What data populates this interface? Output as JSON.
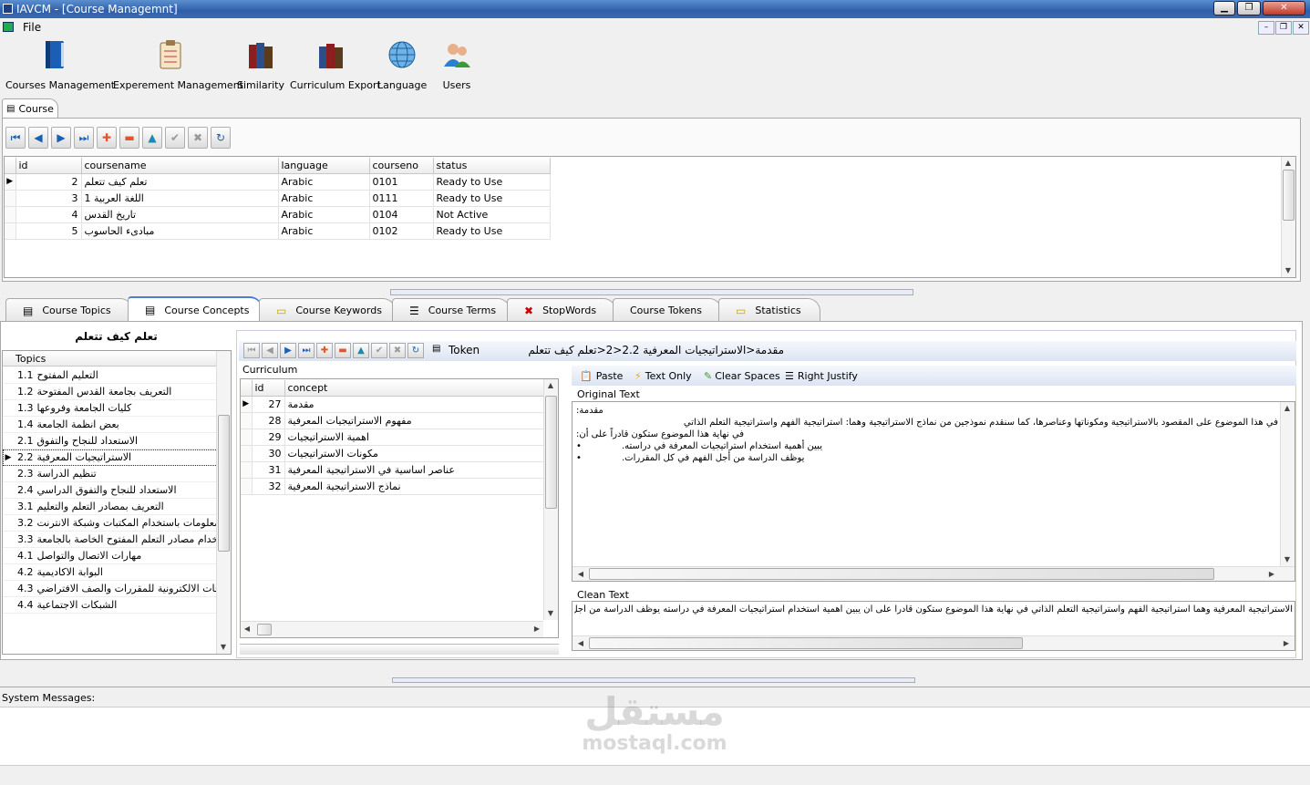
{
  "window": {
    "title": "IAVCM - [Course Managemnt]"
  },
  "menu": {
    "file": "File"
  },
  "toolbar": [
    {
      "label": "Courses Management",
      "icon": "book-icon"
    },
    {
      "label": "Experement Management",
      "icon": "clipboard-icon"
    },
    {
      "label": "Similarity",
      "icon": "books-icon"
    },
    {
      "label": "Curriculum Export",
      "icon": "books-export-icon"
    },
    {
      "label": "Language",
      "icon": "globe-icon"
    },
    {
      "label": "Users",
      "icon": "users-icon"
    }
  ],
  "course_tab": {
    "label": "Course"
  },
  "course_grid": {
    "columns": [
      "id",
      "coursename",
      "language",
      "courseno",
      "status"
    ],
    "rows": [
      {
        "id": "2",
        "name": "تعلم كيف تتعلم",
        "language": "Arabic",
        "courseno": "0101",
        "status": "Ready to Use"
      },
      {
        "id": "3",
        "name": "اللغة العربية 1",
        "language": "Arabic",
        "courseno": "0111",
        "status": "Ready to Use"
      },
      {
        "id": "4",
        "name": "تاريخ القدس",
        "language": "Arabic",
        "courseno": "0104",
        "status": "Not Active"
      },
      {
        "id": "5",
        "name": "مبادىء الحاسوب",
        "language": "Arabic",
        "courseno": "0102",
        "status": "Ready to Use"
      }
    ]
  },
  "tabs": [
    "Course Topics",
    "Course Concepts",
    "Course Keywords",
    "Course Terms",
    "StopWords",
    "Course Tokens",
    "Statistics"
  ],
  "topics": {
    "course_title": "تعلم كيف تتعلم",
    "header": "Topics",
    "items": [
      {
        "num": "1.1",
        "text": "التعليم المفتوح"
      },
      {
        "num": "1.2",
        "text": "التعريف بجامعة القدس المفتوحة"
      },
      {
        "num": "1.3",
        "text": "كليات الجامعة وفروعها"
      },
      {
        "num": "1.4",
        "text": "بعض انظمة الجامعة"
      },
      {
        "num": "2.1",
        "text": "الاستعداد للنجاح والتفوق"
      },
      {
        "num": "2.2",
        "text": "الاستراتيجيات المعرفية"
      },
      {
        "num": "2.3",
        "text": "تنظيم الدراسة"
      },
      {
        "num": "2.4",
        "text": "الاستعداد للنجاح والتفوق الدراسي"
      },
      {
        "num": "3.1",
        "text": "التعريف بمصادر التعلم والتعليم"
      },
      {
        "num": "3.2",
        "text": "المعلومات باستخدام المكتبات وشبكة الانترنت"
      },
      {
        "num": "3.3",
        "text": "استخدام مصادر التعلم المفتوح الخاصة بالجامعة"
      },
      {
        "num": "4.1",
        "text": "مهارات الاتصال والتواصل"
      },
      {
        "num": "4.2",
        "text": "البوابة الاكاديمية"
      },
      {
        "num": "4.3",
        "text": "الصفحات الالكترونية للمقررات والصف الافتراضي"
      },
      {
        "num": "4.4",
        "text": "الشبكات الاجتماعية"
      }
    ]
  },
  "concepts": {
    "token_label": "Token",
    "path": "مقدمة<الاستراتيجيات المعرفية 2.2<2<تعلم كيف تتعلم",
    "curriculum_label": "Curriculum",
    "columns": [
      "id",
      "concept"
    ],
    "rows": [
      {
        "id": "27",
        "concept": "مقدمة"
      },
      {
        "id": "28",
        "concept": "مفهوم الاستراتيجيات المعرفية"
      },
      {
        "id": "29",
        "concept": "اهمية الاستراتيجيات"
      },
      {
        "id": "30",
        "concept": "مكونات الاستراتيجيات"
      },
      {
        "id": "31",
        "concept": "عناصر اساسية في الاستراتيجية المعرفية"
      },
      {
        "id": "32",
        "concept": "نماذج الاستراتيجية المعرفية"
      }
    ]
  },
  "text_tools": {
    "paste": "Paste",
    "text_only": "Text Only",
    "clear_spaces": "Clear Spaces",
    "right_justify": "Right Justify"
  },
  "original_text": {
    "label": "Original Text",
    "lines": [
      "مقدمة:",
      "في هذا الموضوع على المقصود بالاستراتيجية ومكوناتها وعناصرها، كما سنقدم نموذجين من نماذج الاستراتيجية وهما: استراتيجية الفهم واستراتيجية التعلم الذاتي",
      "في نهاية هذا الموضوع ستكون قادراً على أن:",
      "يبين أهمية استخدام استراتيجيات المعرفة في دراسته.",
      "يوظف الدراسة من أجل الفهم في كل المقررات."
    ]
  },
  "clean_text": {
    "label": "Clean Text",
    "value": "الاستراتيجية المعرفية وهما استراتيجية الفهم واستراتيجية التعلم الذاتي في نهاية هذا الموضوع ستكون قادرا على أن يبين أهمية استخدام استراتيجيات المعرفة في دراسته يوظف الدراسة من أجل الفهم في كل المقررات"
  },
  "system": {
    "label": "System Messages:"
  },
  "watermark": {
    "arabic": "مستقل",
    "latin": "mostaql.com"
  }
}
